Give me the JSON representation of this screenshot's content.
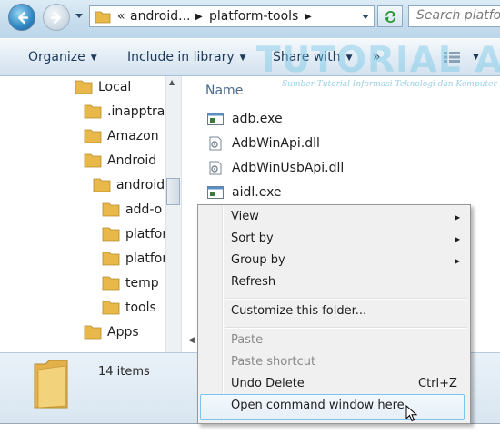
{
  "address": {
    "overflow_marker": "«",
    "breadcrumbs": [
      "android...",
      "platform-tools"
    ],
    "search_placeholder": "Search platform"
  },
  "command_bar": {
    "organize": "Organize",
    "include_in_library": "Include in library",
    "share_with": "Share with",
    "more": "»"
  },
  "navigation": {
    "items": [
      {
        "label": "Local",
        "indent": 0
      },
      {
        "label": ".inapptrac",
        "indent": 1
      },
      {
        "label": "Amazon",
        "indent": 1
      },
      {
        "label": "Android",
        "indent": 1
      },
      {
        "label": "android",
        "indent": 2
      },
      {
        "label": "add-o",
        "indent": 3
      },
      {
        "label": "platfor",
        "indent": 3
      },
      {
        "label": "platfor",
        "indent": 3
      },
      {
        "label": "temp",
        "indent": 3
      },
      {
        "label": "tools",
        "indent": 3
      },
      {
        "label": "Apps",
        "indent": 1
      }
    ]
  },
  "content": {
    "column_header": "Name",
    "files": [
      {
        "name": "adb.exe",
        "icon": "exe-icon"
      },
      {
        "name": "AdbWinApi.dll",
        "icon": "dll-icon"
      },
      {
        "name": "AdbWinUsbApi.dll",
        "icon": "dll-icon"
      },
      {
        "name": "aidl.exe",
        "icon": "exe-icon"
      }
    ]
  },
  "details": {
    "item_count": "14 items"
  },
  "watermark": {
    "title": "TUTORIAL ANKHA",
    "tagline": "Sumber Tutorial Informasi Teknologi dan Komputer"
  },
  "context_menu": {
    "view": "View",
    "sort_by": "Sort by",
    "group_by": "Group by",
    "refresh": "Refresh",
    "customize": "Customize this folder...",
    "paste": "Paste",
    "paste_shortcut": "Paste shortcut",
    "undo_delete": "Undo Delete",
    "undo_shortcut": "Ctrl+Z",
    "open_cmd": "Open command window here"
  },
  "colors": {
    "hover_border": "#7ec3ee",
    "folder": "#e8b94a",
    "watermark": "#78c8e6"
  }
}
